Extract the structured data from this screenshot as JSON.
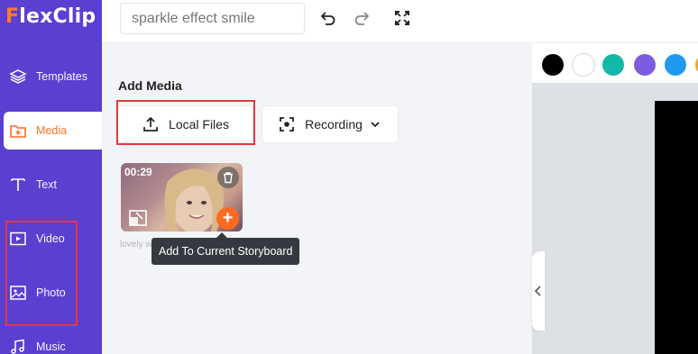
{
  "app": {
    "logo_text": "lexClip",
    "logo_letter": "F"
  },
  "sidebar": {
    "items": [
      {
        "label": "Templates",
        "icon": "layers-icon"
      },
      {
        "label": "Media",
        "icon": "folder-plus-icon",
        "active": true
      },
      {
        "label": "Text",
        "icon": "text-t-icon"
      },
      {
        "label": "Video",
        "icon": "video-play-icon"
      },
      {
        "label": "Photo",
        "icon": "image-icon"
      },
      {
        "label": "Music",
        "icon": "music-icon"
      }
    ]
  },
  "topbar": {
    "search_placeholder": "sparkle effect smile",
    "undo_icon": "undo-icon",
    "redo_icon": "redo-icon",
    "fullscreen_icon": "fullscreen-icon"
  },
  "media": {
    "title": "Add Media",
    "local_files_label": "Local Files",
    "recording_label": "Recording",
    "clip": {
      "duration": "00:29",
      "name": "lovely w"
    },
    "tooltip": "Add To Current Storyboard",
    "add_symbol": "+"
  },
  "colors": {
    "accent": "#ff6a1f",
    "sidebar_bg": "#5b3fd1",
    "swatches": [
      "#000000",
      "#ffffff",
      "#14b8a6",
      "#7c5ce0",
      "#1e9bf0",
      "#f5a623"
    ]
  }
}
